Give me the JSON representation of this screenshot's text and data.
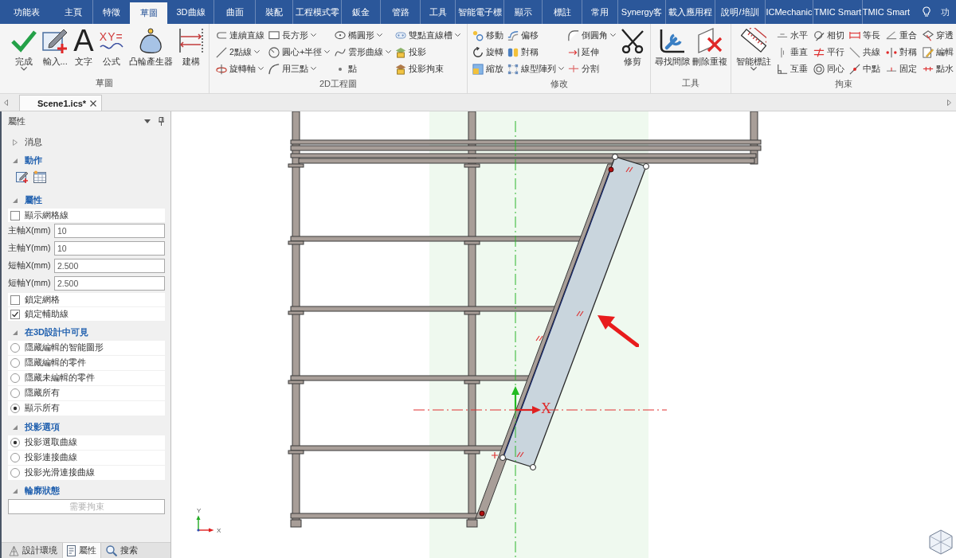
{
  "menu_tabs": [
    {
      "label": "功能表",
      "selected": false
    },
    {
      "label": "主頁",
      "selected": false
    },
    {
      "label": "特徵",
      "selected": false
    },
    {
      "label": "草圖",
      "selected": true
    },
    {
      "label": "3D曲線",
      "selected": false
    },
    {
      "label": "曲面",
      "selected": false
    },
    {
      "label": "裝配",
      "selected": false
    },
    {
      "label": "工程模式零",
      "selected": false
    },
    {
      "label": "鈑金",
      "selected": false
    },
    {
      "label": "管路",
      "selected": false
    },
    {
      "label": "工具",
      "selected": false
    },
    {
      "label": "智能電子標",
      "selected": false
    },
    {
      "label": "顯示",
      "selected": false
    },
    {
      "label": "標註",
      "selected": false
    },
    {
      "label": "常用",
      "selected": false
    },
    {
      "label": "Synergy客",
      "selected": false
    },
    {
      "label": "載入應用程",
      "selected": false
    },
    {
      "label": "說明/培訓",
      "selected": false
    },
    {
      "label": "ICMechanic",
      "selected": false
    },
    {
      "label": "TMIC Smart",
      "selected": false
    },
    {
      "label": "TMIC Smart",
      "selected": false
    }
  ],
  "tell_me": {
    "label": "功"
  },
  "ribbon": {
    "groups": [
      {
        "label": "草圖",
        "items": [
          {
            "kind": "large",
            "label": "完成",
            "dropdown": true
          },
          {
            "kind": "large",
            "label": "輸入...",
            "dropdown": false
          },
          {
            "kind": "large",
            "label": "文字",
            "glyph": "A",
            "dropdown": false
          },
          {
            "kind": "large",
            "label": "公式",
            "glyph": "XY=",
            "dropdown": false
          },
          {
            "kind": "large",
            "label": "凸輪產生器",
            "dropdown": false
          },
          {
            "kind": "large",
            "label": "建構",
            "dropdown": false
          }
        ]
      },
      {
        "label": "2D工程圖",
        "items": [
          {
            "kind": "column",
            "buttons": [
              {
                "label": "連續直線",
                "dropdown": false
              },
              {
                "label": "2點線",
                "dropdown": true
              },
              {
                "label": "旋轉軸",
                "dropdown": true
              }
            ]
          },
          {
            "kind": "column",
            "buttons": [
              {
                "label": "長方形",
                "dropdown": true
              },
              {
                "label": "圓心+半徑",
                "dropdown": true
              },
              {
                "label": "用三點",
                "dropdown": true
              }
            ]
          },
          {
            "kind": "column",
            "buttons": [
              {
                "label": "橢圓形",
                "dropdown": true
              },
              {
                "label": "雲形曲線",
                "dropdown": true
              },
              {
                "label": "點",
                "dropdown": false
              }
            ]
          },
          {
            "kind": "column",
            "buttons": [
              {
                "label": "雙點直線槽",
                "dropdown": true
              },
              {
                "label": "投影",
                "dropdown": false
              },
              {
                "label": "投影拘束",
                "dropdown": false
              }
            ]
          }
        ]
      },
      {
        "label": "修改",
        "items": [
          {
            "kind": "column",
            "buttons": [
              {
                "label": "移動",
                "dropdown": false
              },
              {
                "label": "旋轉",
                "dropdown": false
              },
              {
                "label": "縮放",
                "dropdown": false
              }
            ]
          },
          {
            "kind": "column",
            "buttons": [
              {
                "label": "偏移",
                "dropdown": false
              },
              {
                "label": "對稱",
                "dropdown": false
              },
              {
                "label": "線型陣列",
                "dropdown": true
              }
            ]
          },
          {
            "kind": "column",
            "buttons": [
              {
                "label": "倒圓角",
                "dropdown": true
              },
              {
                "label": "延伸",
                "dropdown": false
              },
              {
                "label": "分割",
                "dropdown": false
              }
            ]
          },
          {
            "kind": "large",
            "label": "修剪",
            "dropdown": false
          }
        ]
      },
      {
        "label": "工具",
        "items": [
          {
            "kind": "large",
            "label": "尋找間隙",
            "dropdown": false
          },
          {
            "kind": "large",
            "label": "刪除重複",
            "dropdown": false
          }
        ]
      },
      {
        "label": "拘束",
        "items": [
          {
            "kind": "large",
            "label": "智能標註",
            "dropdown": true
          },
          {
            "kind": "column",
            "buttons": [
              {
                "label": "水平",
                "dropdown": false
              },
              {
                "label": "垂直",
                "dropdown": false
              },
              {
                "label": "互垂",
                "dropdown": false
              }
            ]
          },
          {
            "kind": "column",
            "buttons": [
              {
                "label": "相切",
                "dropdown": false
              },
              {
                "label": "平行",
                "dropdown": false
              },
              {
                "label": "同心",
                "dropdown": false
              }
            ]
          },
          {
            "kind": "column",
            "buttons": [
              {
                "label": "等長",
                "dropdown": false
              },
              {
                "label": "共線",
                "dropdown": false
              },
              {
                "label": "中點",
                "dropdown": false
              }
            ]
          },
          {
            "kind": "column",
            "buttons": [
              {
                "label": "重合",
                "dropdown": false
              },
              {
                "label": "對稱",
                "dropdown": false
              },
              {
                "label": "固定",
                "dropdown": false
              }
            ]
          },
          {
            "kind": "column",
            "buttons": [
              {
                "label": "穿透",
                "dropdown": false
              },
              {
                "label": "編輯",
                "dropdown": false
              },
              {
                "label": "點水",
                "dropdown": false
              }
            ]
          }
        ]
      }
    ]
  },
  "document_tabs": [
    {
      "label": "Scene1.ics*",
      "selected": true
    }
  ],
  "properties_panel": {
    "title": "屬性",
    "sections": [
      {
        "title": "消息",
        "expanded": false
      },
      {
        "title": "動作",
        "expanded": true,
        "rows": [
          {
            "kind": "toolbar"
          }
        ]
      },
      {
        "title": "屬性",
        "expanded": true,
        "rows": [
          {
            "kind": "checkbox",
            "label": "顯示網格線",
            "checked": false
          },
          {
            "kind": "field",
            "label": "主軸X(mm)",
            "value": "10"
          },
          {
            "kind": "field",
            "label": "主軸Y(mm)",
            "value": "10"
          },
          {
            "kind": "field",
            "label": "短軸X(mm)",
            "value": "2.500"
          },
          {
            "kind": "field",
            "label": "短軸Y(mm)",
            "value": "2.500"
          },
          {
            "kind": "checkbox",
            "label": "鎖定網格",
            "checked": false
          },
          {
            "kind": "checkbox",
            "label": "鎖定輔助線",
            "checked": true
          }
        ]
      },
      {
        "title": "在3D設計中可見",
        "expanded": true,
        "rows": [
          {
            "kind": "radio",
            "label": "隱藏編輯的智能圖形",
            "selected": false
          },
          {
            "kind": "radio",
            "label": "隱藏編輯的零件",
            "selected": false
          },
          {
            "kind": "radio",
            "label": "隱藏未編輯的零件",
            "selected": false
          },
          {
            "kind": "radio",
            "label": "隱藏所有",
            "selected": false
          },
          {
            "kind": "radio",
            "label": "顯示所有",
            "selected": true
          }
        ]
      },
      {
        "title": "投影選項",
        "expanded": true,
        "rows": [
          {
            "kind": "radio",
            "label": "投影選取曲線",
            "selected": true
          },
          {
            "kind": "radio",
            "label": "投影連接曲線",
            "selected": false
          },
          {
            "kind": "radio",
            "label": "投影光滑連接曲線",
            "selected": false
          }
        ]
      },
      {
        "title": "輪廓狀態",
        "expanded": true,
        "rows": [
          {
            "kind": "status",
            "value": "需要拘束"
          }
        ]
      }
    ],
    "bottom_tabs": [
      {
        "label": "設計環境",
        "selected": false
      },
      {
        "label": "屬性",
        "selected": true
      },
      {
        "label": "搜索",
        "selected": false
      }
    ]
  },
  "canvas": {
    "axis_label": "X",
    "triad": {
      "y_label": "Y",
      "x_label": "X"
    }
  }
}
